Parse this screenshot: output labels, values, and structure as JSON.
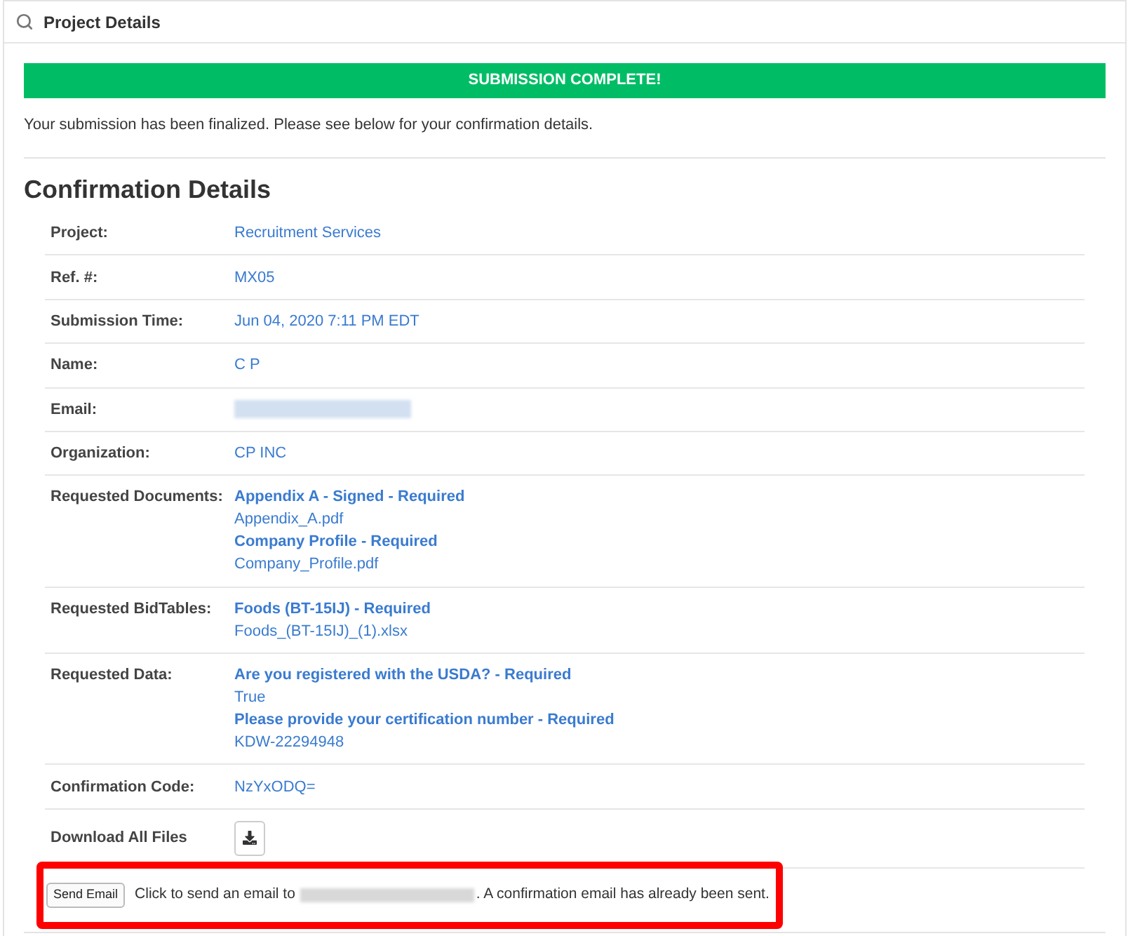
{
  "panel": {
    "title": "Project Details"
  },
  "banner": {
    "text": "SUBMISSION COMPLETE!"
  },
  "message": "Your submission has been finalized. Please see below for your confirmation details.",
  "heading": "Confirmation Details",
  "rows": [
    {
      "label": "Project:",
      "kind": "text",
      "value": "Recruitment Services"
    },
    {
      "label": "Ref. #:",
      "kind": "text",
      "value": "MX05"
    },
    {
      "label": "Submission Time:",
      "kind": "text",
      "value": "Jun 04, 2020 7:11 PM EDT"
    },
    {
      "label": "Name:",
      "kind": "text",
      "value": "C P"
    },
    {
      "label": "Email:",
      "kind": "redacted"
    },
    {
      "label": "Organization:",
      "kind": "text",
      "value": "CP INC"
    },
    {
      "label": "Requested Documents:",
      "kind": "list",
      "items": [
        {
          "kind": "requirement",
          "text": "Appendix A - Signed - Required"
        },
        {
          "kind": "file",
          "text": "Appendix_A.pdf"
        },
        {
          "kind": "requirement",
          "text": "Company Profile - Required"
        },
        {
          "kind": "file",
          "text": "Company_Profile.pdf"
        }
      ]
    },
    {
      "label": "Requested BidTables:",
      "kind": "list",
      "items": [
        {
          "kind": "requirement",
          "text": "Foods (BT-15IJ) - Required"
        },
        {
          "kind": "file",
          "text": "Foods_(BT-15IJ)_(1).xlsx"
        }
      ]
    },
    {
      "label": "Requested Data:",
      "kind": "list",
      "items": [
        {
          "kind": "requirement",
          "text": "Are you registered with the USDA? - Required"
        },
        {
          "kind": "answer",
          "text": "True"
        },
        {
          "kind": "requirement",
          "text": "Please provide your certification number - Required"
        },
        {
          "kind": "answer",
          "text": "KDW-22294948"
        }
      ]
    },
    {
      "label": "Confirmation Code:",
      "kind": "text",
      "value": "NzYxODQ="
    },
    {
      "label": "Download All Files",
      "kind": "download"
    }
  ],
  "send_email": {
    "button": "Send Email",
    "text": "Click to send an email to",
    "redacted": true,
    "text_after": ". A confirmation email has already been sent.",
    "highlighted": true
  }
}
